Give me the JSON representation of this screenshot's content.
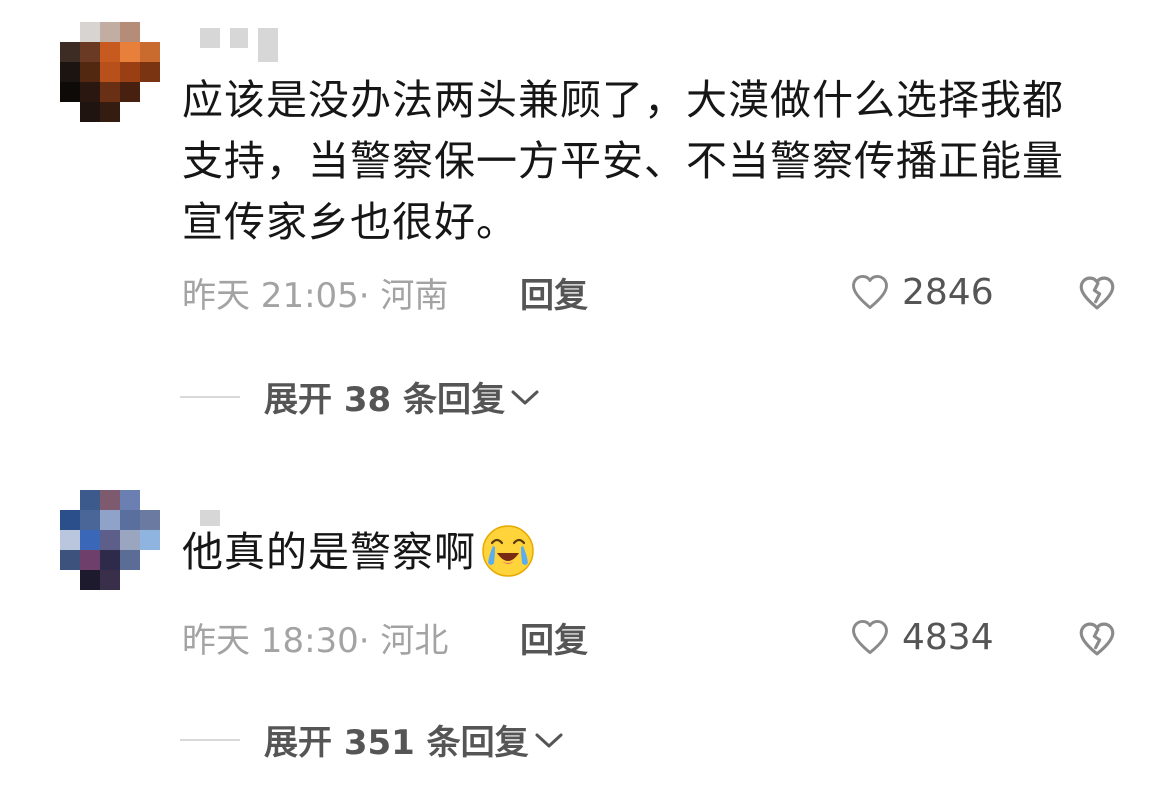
{
  "comments": [
    {
      "text": "应该是没办法两头兼顾了，大漠做什么选择我都支持，当警察保一方平安、不当警察传播正能量宣传家乡也很好。",
      "time": "昨天 21:05",
      "location": "· 河南",
      "reply_label": "回复",
      "likes": "2846",
      "expand_label": "展开 38 条回复"
    },
    {
      "text": "他真的是警察啊",
      "emoji": "cry-laugh-emoji",
      "time": "昨天 18:30",
      "location": "· 河北",
      "reply_label": "回复",
      "likes": "4834",
      "expand_label": "展开 351 条回复"
    }
  ],
  "colors": {
    "text": "#161616",
    "meta": "#a3a3a3",
    "action": "#555555"
  }
}
